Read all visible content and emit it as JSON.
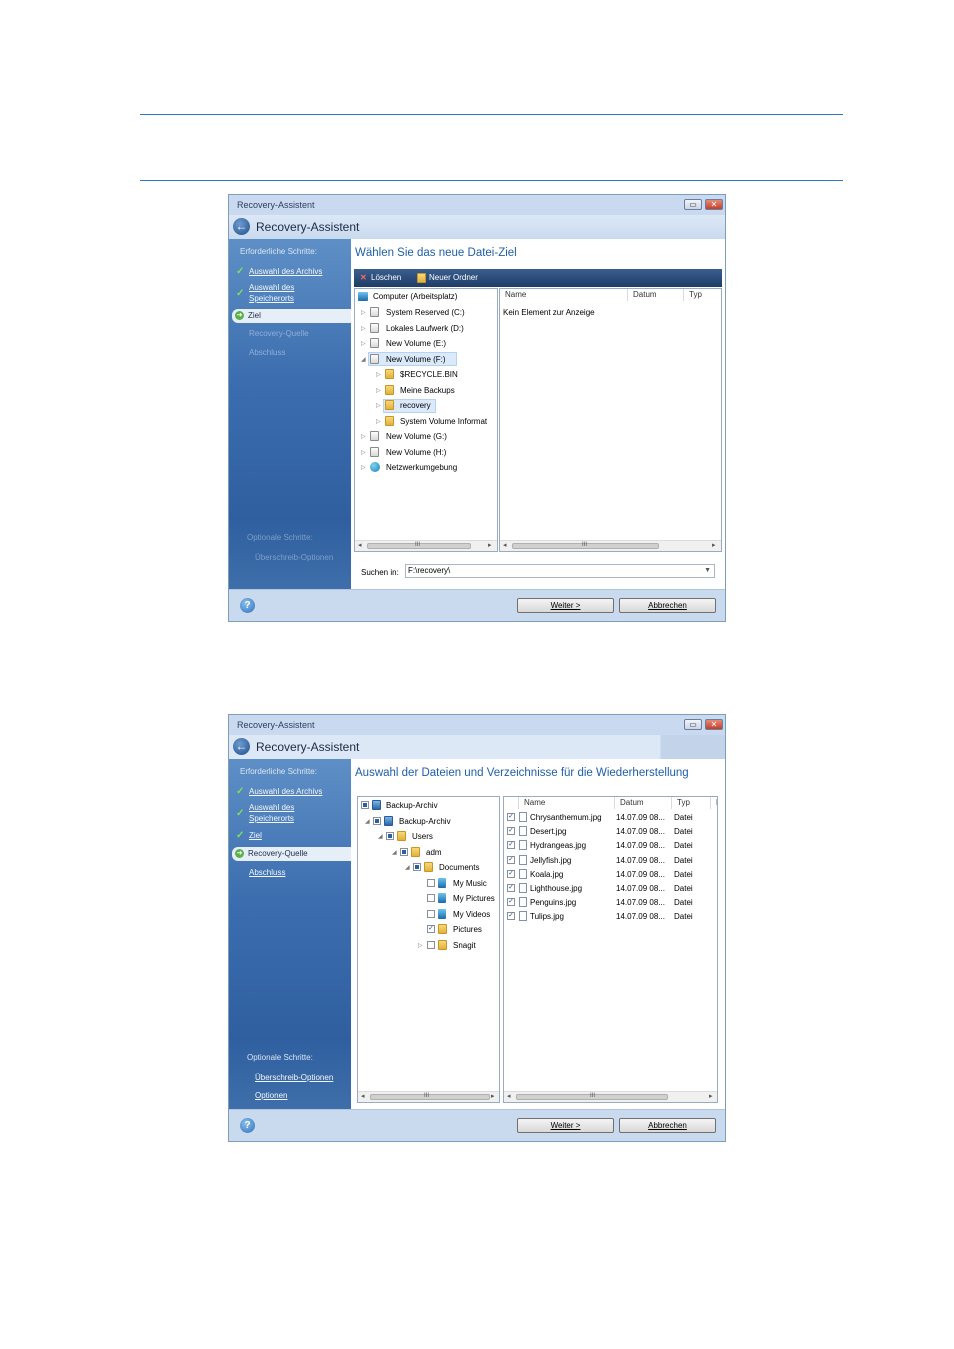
{
  "win1": {
    "title": "Recovery-Assistent",
    "header": "Recovery-Assistent",
    "min_btn": "▭",
    "close_btn": "✕",
    "sidebar": {
      "heading": "Erforderliche Schritte:",
      "step1": "Auswahl des Archivs",
      "step2a": "Auswahl des",
      "step2b": "Speicherorts",
      "step3": "Ziel",
      "step4": "Recovery-Quelle",
      "step5": "Abschluss",
      "opt_heading": "Optionale Schritte:",
      "opt1": "Überschreib-Optionen"
    },
    "content_title": "Wählen Sie das neue Datei-Ziel",
    "toolbar": {
      "delete": "Löschen",
      "new_folder": "Neuer Ordner"
    },
    "tree": [
      "Computer (Arbeitsplatz)",
      "System Reserved (C:)",
      "Lokales Laufwerk (D:)",
      "New Volume (E:)",
      "New Volume (F:)",
      "$RECYCLE.BIN",
      "Meine Backups",
      "recovery",
      "System Volume Informat",
      "New Volume (G:)",
      "New Volume (H:)",
      "Netzwerkumgebung"
    ],
    "columns": [
      "Name",
      "Datum",
      "Typ"
    ],
    "empty_text": "Kein Element zur Anzeige",
    "scroll_mid": "III",
    "search_label": "Suchen in:",
    "search_value": "F:\\recovery\\",
    "next": "Weiter >",
    "cancel": "Abbrechen",
    "help": "?"
  },
  "win2": {
    "title": "Recovery-Assistent",
    "header": "Recovery-Assistent",
    "sidebar": {
      "heading": "Erforderliche Schritte:",
      "step1": "Auswahl des Archivs",
      "step2a": "Auswahl des",
      "step2b": "Speicherorts",
      "step3": "Ziel",
      "step4": "Recovery-Quelle",
      "step5": "Abschluss",
      "opt_heading": "Optionale Schritte:",
      "opt1": "Überschreib-Optionen",
      "opt2": "Optionen"
    },
    "content_title": "Auswahl der Dateien und Verzeichnisse für die Wiederherstellung",
    "tree": [
      "Backup-Archiv",
      "Backup-Archiv",
      "Users",
      "adm",
      "Documents",
      "My Music",
      "My Pictures",
      "My Videos",
      "Pictures",
      "Snagit"
    ],
    "columns": [
      "Name",
      "Datum",
      "Typ",
      "F"
    ],
    "files": [
      {
        "name": "Chrysanthemum.jpg",
        "date": "14.07.09 08...",
        "type": "Datei"
      },
      {
        "name": "Desert.jpg",
        "date": "14.07.09 08...",
        "type": "Datei"
      },
      {
        "name": "Hydrangeas.jpg",
        "date": "14.07.09 08...",
        "type": "Datei"
      },
      {
        "name": "Jellyfish.jpg",
        "date": "14.07.09 08...",
        "type": "Datei"
      },
      {
        "name": "Koala.jpg",
        "date": "14.07.09 08...",
        "type": "Datei"
      },
      {
        "name": "Lighthouse.jpg",
        "date": "14.07.09 08...",
        "type": "Datei"
      },
      {
        "name": "Penguins.jpg",
        "date": "14.07.09 08...",
        "type": "Datei"
      },
      {
        "name": "Tulips.jpg",
        "date": "14.07.09 08...",
        "type": "Datei"
      }
    ],
    "scroll_mid": "III",
    "next": "Weiter >",
    "cancel": "Abbrechen",
    "help": "?"
  }
}
